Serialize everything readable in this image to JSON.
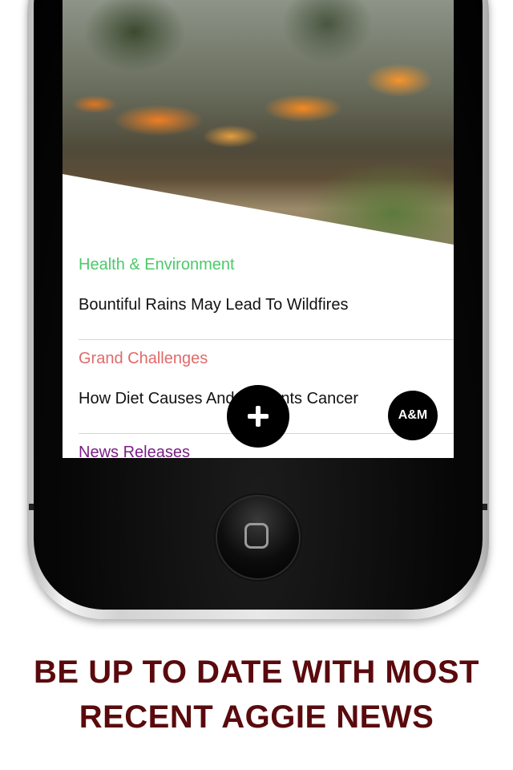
{
  "news": [
    {
      "category": "Health & Environment",
      "category_color": "#4cc96a",
      "headline": "Bountiful Rains May Lead To Wildfires"
    },
    {
      "category": "Grand Challenges",
      "category_color": "#e06a6a",
      "headline": "How Diet Causes And Prevents Cancer"
    },
    {
      "category": "News Releases",
      "category_color": "#7a1f86",
      "headline": ""
    }
  ],
  "buttons": {
    "add_icon": "plus-icon",
    "brand_label": "A&M"
  },
  "caption": {
    "line1": "BE UP TO DATE WITH MOST",
    "line2": "RECENT AGGIE NEWS",
    "color": "#5a0a0d"
  }
}
